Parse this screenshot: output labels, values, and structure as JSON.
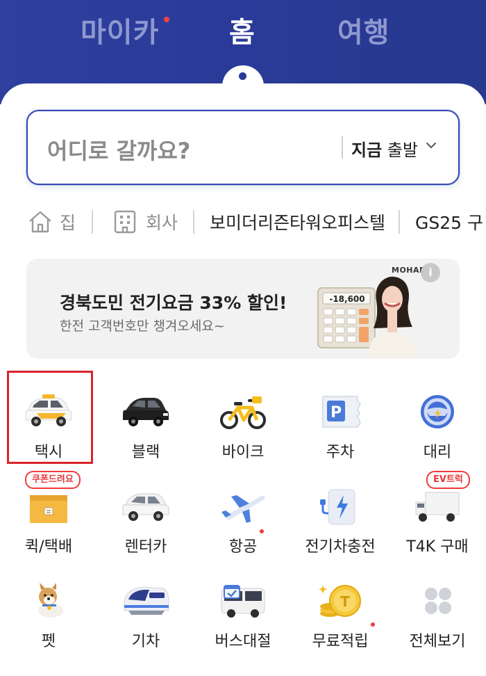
{
  "header": {
    "tabs": [
      {
        "label": "마이카",
        "has_dot": true
      },
      {
        "label": "홈",
        "active": true
      },
      {
        "label": "여행"
      }
    ],
    "accent_color": "#2a3a98"
  },
  "search": {
    "placeholder": "어디로 갈까요?",
    "depart_bold": "지금",
    "depart_rest": " 출발"
  },
  "shortcuts": [
    {
      "label": "집",
      "icon": "home-icon"
    },
    {
      "label": "회사",
      "icon": "building-icon"
    },
    {
      "label": "보미더리즌타워오피스텔"
    },
    {
      "label": "GS25 구"
    }
  ],
  "banner": {
    "title": "경북도민 전기요금 33% 할인!",
    "subtitle": "한전 고객번호만 챙겨오세요~",
    "brand": "MOHAET",
    "calculator_display": "-18,600"
  },
  "services": [
    {
      "label": "택시",
      "icon": "taxi-icon"
    },
    {
      "label": "블랙",
      "icon": "black-car-icon"
    },
    {
      "label": "바이크",
      "icon": "bike-icon"
    },
    {
      "label": "주차",
      "icon": "parking-icon"
    },
    {
      "label": "대리",
      "icon": "steering-wheel-icon"
    },
    {
      "label": "퀵/택배",
      "icon": "parcel-box-icon",
      "badge": "쿠폰드려요"
    },
    {
      "label": "렌터카",
      "icon": "rental-car-icon"
    },
    {
      "label": "항공",
      "icon": "airplane-icon",
      "new": true
    },
    {
      "label": "전기차충전",
      "icon": "ev-charger-icon"
    },
    {
      "label": "T4K 구매",
      "icon": "truck-icon",
      "badge": "EV트럭"
    },
    {
      "label": "펫",
      "icon": "dog-icon"
    },
    {
      "label": "기차",
      "icon": "train-icon"
    },
    {
      "label": "버스대절",
      "icon": "bus-icon"
    },
    {
      "label": "무료적립",
      "icon": "coin-icon",
      "new": true
    },
    {
      "label": "전체보기",
      "icon": "grid-icon"
    }
  ]
}
